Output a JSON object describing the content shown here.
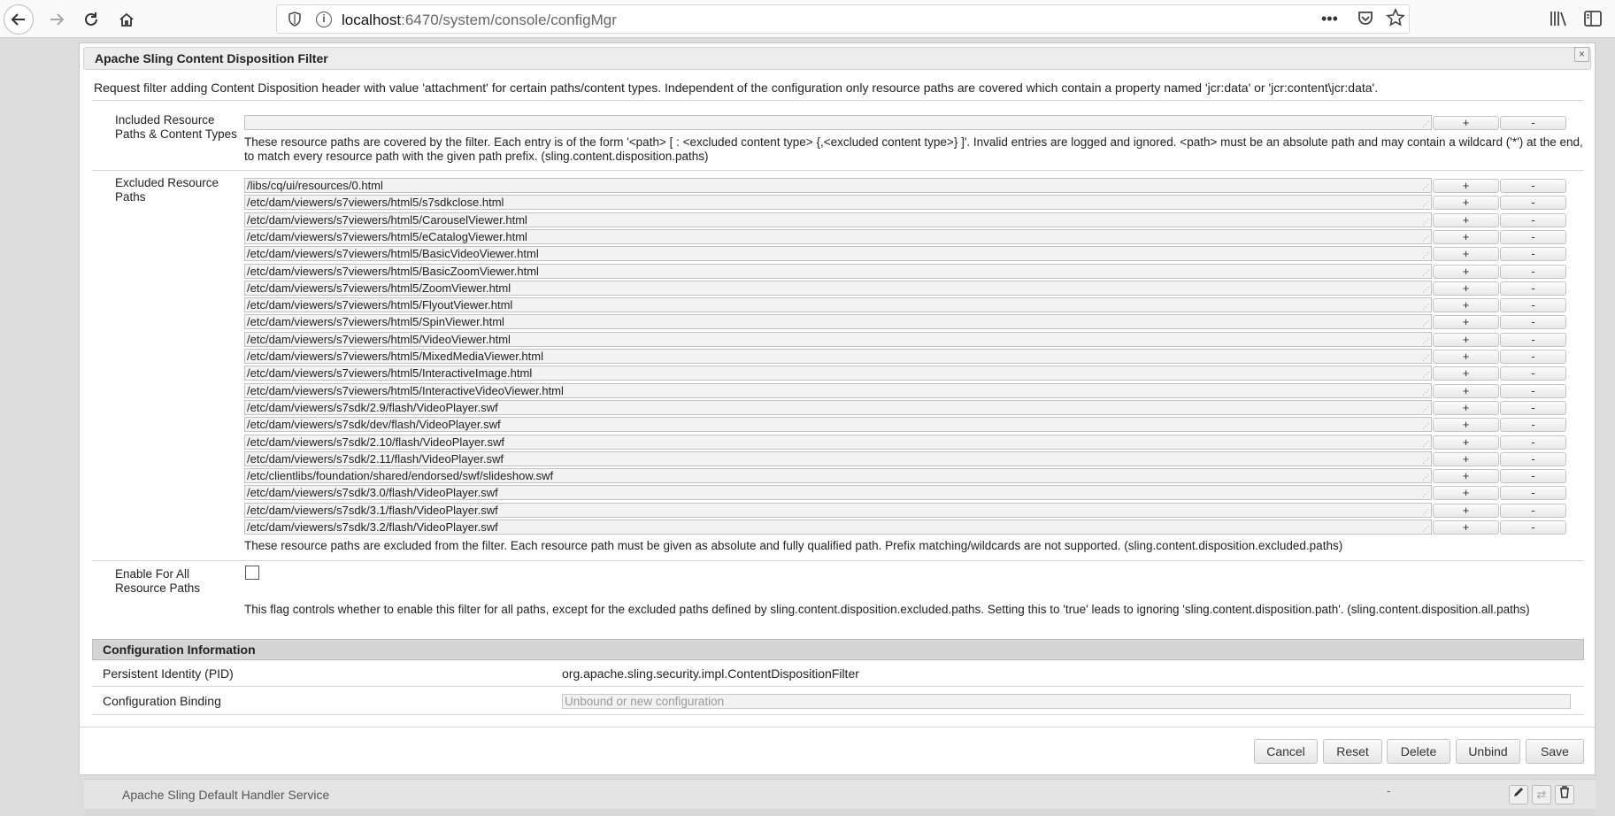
{
  "browser": {
    "url_host": "localhost",
    "url_rest": ":6470/system/console/configMgr",
    "icons": [
      "back-icon",
      "forward-icon",
      "reload-icon",
      "home-icon",
      "shield-icon",
      "info-icon",
      "more-icon",
      "pocket-icon",
      "bookmark-star-icon",
      "library-icon",
      "sidebar-icon"
    ]
  },
  "dialog": {
    "title": "Apache Sling Content Disposition Filter",
    "close_label": "×",
    "description": "Request filter adding Content Disposition header with value 'attachment' for certain paths/content types. Independent of the configuration only resource paths are covered which contain a property named 'jcr:data' or 'jcr:content\\jcr:data'.",
    "included": {
      "label": "Included Resource Paths & Content Types",
      "value": "",
      "hint": "These resource paths are covered by the filter. Each entry is of the form '<path> [ : <excluded content type> {,<excluded content type>} ]'. Invalid entries are logged and ignored. <path> must be an absolute path and may contain a wildcard ('*') at the end, to match every resource path with the given path prefix. (sling.content.disposition.paths)"
    },
    "excluded": {
      "label": "Excluded Resource Paths",
      "values": [
        "/libs/cq/ui/resources/0.html",
        "/etc/dam/viewers/s7viewers/html5/s7sdkclose.html",
        "/etc/dam/viewers/s7viewers/html5/CarouselViewer.html",
        "/etc/dam/viewers/s7viewers/html5/eCatalogViewer.html",
        "/etc/dam/viewers/s7viewers/html5/BasicVideoViewer.html",
        "/etc/dam/viewers/s7viewers/html5/BasicZoomViewer.html",
        "/etc/dam/viewers/s7viewers/html5/ZoomViewer.html",
        "/etc/dam/viewers/s7viewers/html5/FlyoutViewer.html",
        "/etc/dam/viewers/s7viewers/html5/SpinViewer.html",
        "/etc/dam/viewers/s7viewers/html5/VideoViewer.html",
        "/etc/dam/viewers/s7viewers/html5/MixedMediaViewer.html",
        "/etc/dam/viewers/s7viewers/html5/InteractiveImage.html",
        "/etc/dam/viewers/s7viewers/html5/InteractiveVideoViewer.html",
        "/etc/dam/viewers/s7sdk/2.9/flash/VideoPlayer.swf",
        "/etc/dam/viewers/s7sdk/dev/flash/VideoPlayer.swf",
        "/etc/dam/viewers/s7sdk/2.10/flash/VideoPlayer.swf",
        "/etc/dam/viewers/s7sdk/2.11/flash/VideoPlayer.swf",
        "/etc/clientlibs/foundation/shared/endorsed/swf/slideshow.swf",
        "/etc/dam/viewers/s7sdk/3.0/flash/VideoPlayer.swf",
        "/etc/dam/viewers/s7sdk/3.1/flash/VideoPlayer.swf",
        "/etc/dam/viewers/s7sdk/3.2/flash/VideoPlayer.swf"
      ],
      "hint": "These resource paths are excluded from the filter. Each resource path must be given as absolute and fully qualified path. Prefix matching/wildcards are not supported. (sling.content.disposition.excluded.paths)"
    },
    "enable_all": {
      "label": "Enable For All Resource Paths",
      "checked": false,
      "hint": "This flag controls whether to enable this filter for all paths, except for the excluded paths defined by sling.content.disposition.excluded.paths. Setting this to 'true' leads to ignoring 'sling.content.disposition.path'. (sling.content.disposition.all.paths)"
    },
    "plus_label": "+",
    "minus_label": "-",
    "config_info": {
      "header": "Configuration Information",
      "pid_label": "Persistent Identity (PID)",
      "pid_value": "org.apache.sling.security.impl.ContentDispositionFilter",
      "binding_label": "Configuration Binding",
      "binding_placeholder": "Unbound or new configuration"
    },
    "buttons": {
      "cancel": "Cancel",
      "reset": "Reset",
      "delete": "Delete",
      "unbind": "Unbind",
      "save": "Save"
    }
  },
  "background_list": {
    "row_name": "Apache Sling Default Handler Service",
    "row_status": "-"
  }
}
